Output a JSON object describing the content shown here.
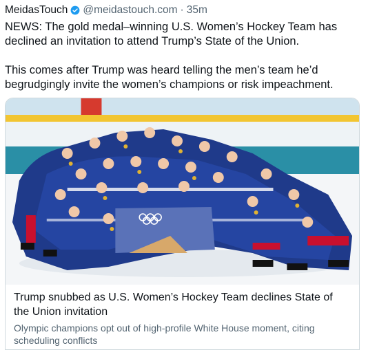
{
  "post": {
    "author": "MeidasTouch",
    "handle": "@meidastouch.com",
    "separator": "·",
    "time": "35m",
    "paragraphs": [
      "NEWS: The gold medal–winning U.S. Women’s Hockey Team has declined an invitation to attend Trump’s State of the Union.",
      "This comes after Trump was heard telling the men’s team he’d begrudgingly invite the women’s champions or risk impeachment."
    ]
  },
  "card": {
    "title": "Trump snubbed as U.S. Women’s Hockey Team declines State of the Union invitation",
    "description": "Olympic champions opt out of high-profile White House moment, citing scheduling conflicts",
    "image_icon": "team-photo-image"
  },
  "colors": {
    "verified_badge": "#1d9bf0",
    "secondary_text": "#536471",
    "card_border": "#cfd9de",
    "jersey_navy": "#1f3a8a",
    "rink_stripe": "#2a8fa6"
  }
}
